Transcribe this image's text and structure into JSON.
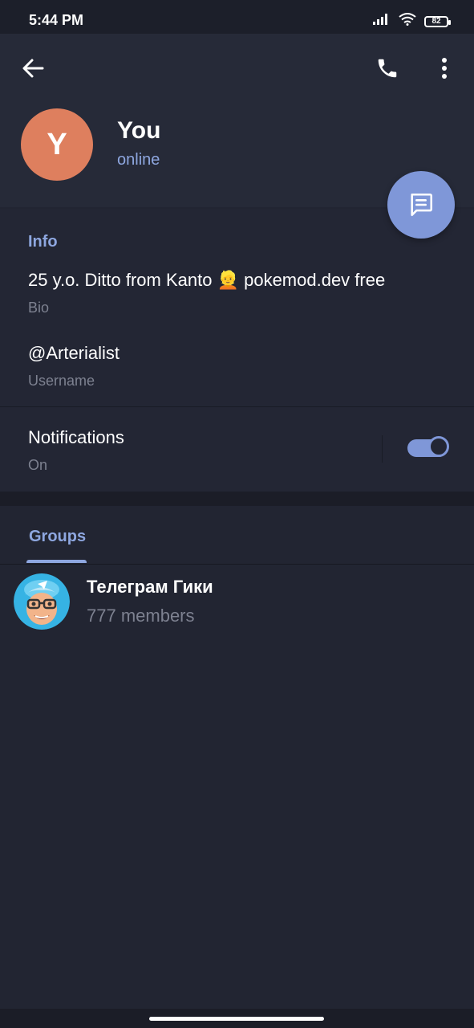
{
  "status_bar": {
    "time": "5:44 PM",
    "battery": "82"
  },
  "profile": {
    "avatar_letter": "Y",
    "name": "You",
    "status": "online"
  },
  "info": {
    "section_title": "Info",
    "bio_value": "25 y.o. Ditto from Kanto 👱 pokemod.dev free",
    "bio_label": "Bio",
    "username_value": "@Arterialist",
    "username_label": "Username",
    "notifications_label": "Notifications",
    "notifications_state": "On",
    "notifications_enabled": true
  },
  "groups": {
    "tab_label": "Groups",
    "items": [
      {
        "name": "Телеграм Гики",
        "members": "777 members"
      }
    ]
  },
  "colors": {
    "accent": "#8ea7e0",
    "fab": "#7f97d8",
    "avatar": "#de7f5e",
    "background": "#222532"
  }
}
